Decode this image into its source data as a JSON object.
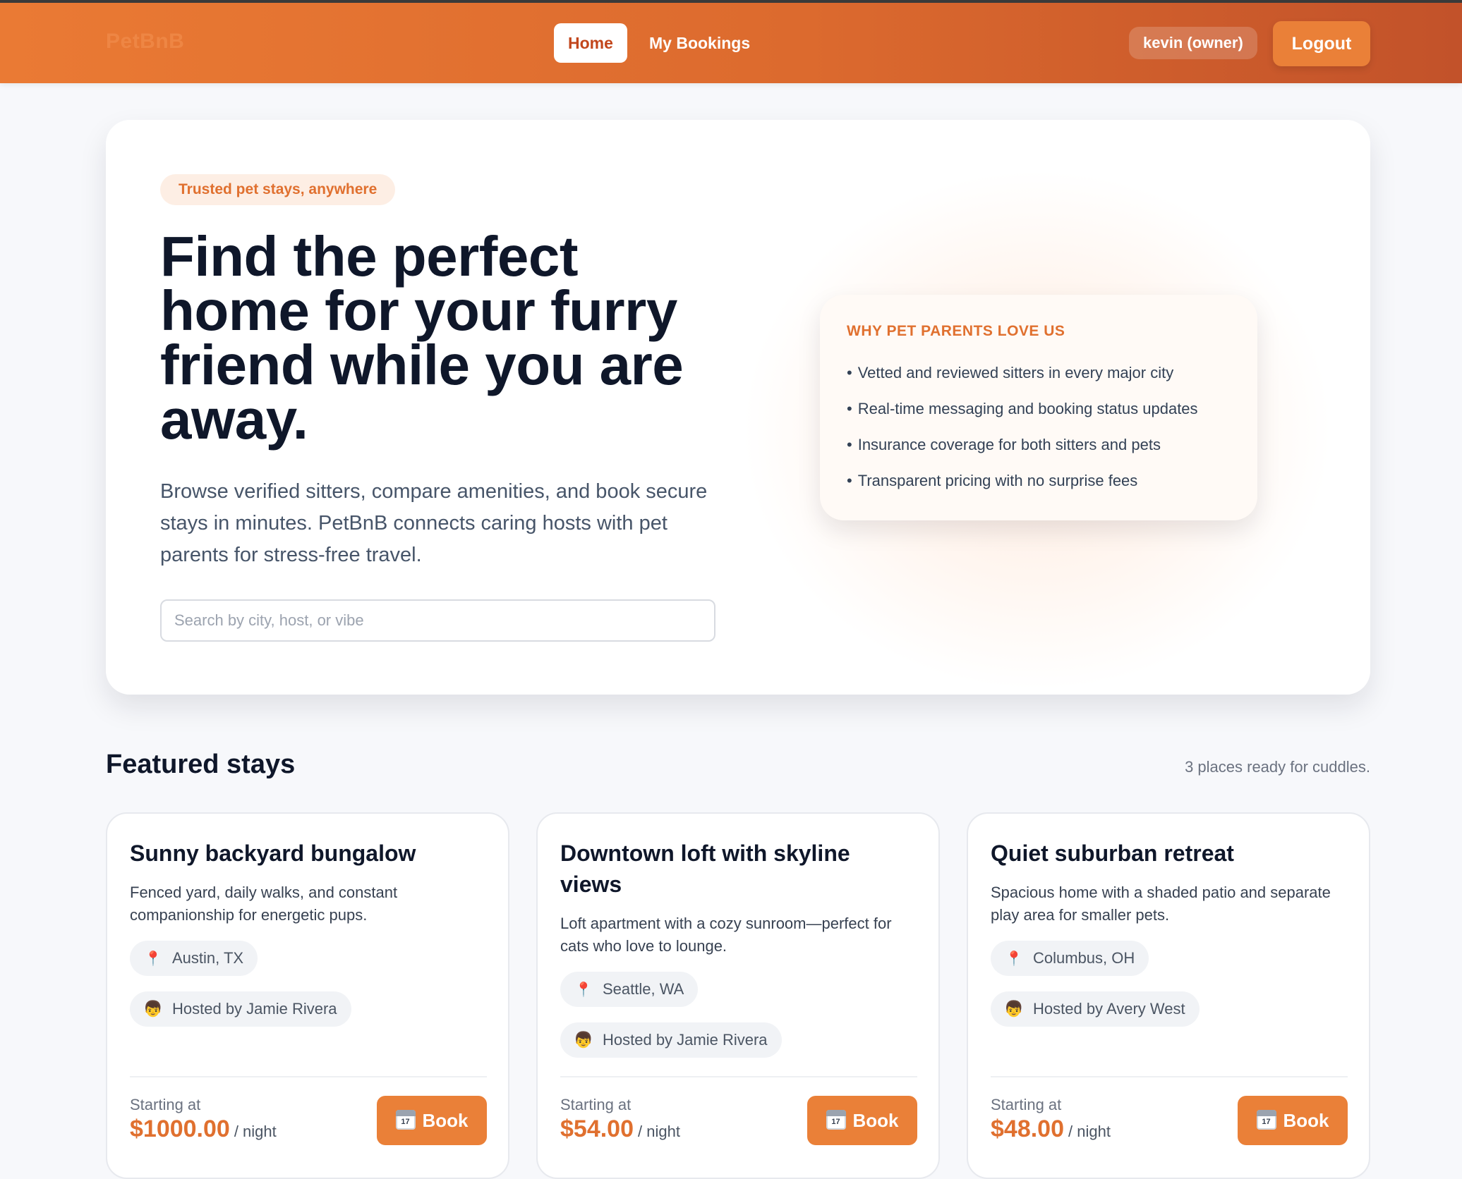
{
  "nav": {
    "brand": "PetBnB",
    "home": "Home",
    "bookings": "My Bookings",
    "user": "kevin (owner)",
    "logout": "Logout"
  },
  "hero": {
    "badge": "Trusted pet stays, anywhere",
    "title": "Find the perfect home for your furry friend while you are away.",
    "description": "Browse verified sitters, compare amenities, and book secure stays in minutes. PetBnB connects caring hosts with pet parents for stress-free travel.",
    "search_placeholder": "Search by city, host, or vibe",
    "why": {
      "title": "WHY PET PARENTS LOVE US",
      "items": [
        "Vetted and reviewed sitters in every major city",
        "Real-time messaging and booking status updates",
        "Insurance coverage for both sitters and pets",
        "Transparent pricing with no surprise fees"
      ]
    }
  },
  "featured": {
    "title": "Featured stays",
    "subtitle": "3 places ready for cuddles.",
    "stays": [
      {
        "title": "Sunny backyard bungalow",
        "description": "Fenced yard, daily walks, and constant companionship for energetic pups.",
        "location": "Austin, TX",
        "host": "Hosted by Jamie Rivera",
        "starting_label": "Starting at",
        "price": "$1000.00",
        "per_night": "/ night",
        "book_label": "Book"
      },
      {
        "title": "Downtown loft with skyline views",
        "description": "Loft apartment with a cozy sunroom—perfect for cats who love to lounge.",
        "location": "Seattle, WA",
        "host": "Hosted by Jamie Rivera",
        "starting_label": "Starting at",
        "price": "$54.00",
        "per_night": "/ night",
        "book_label": "Book"
      },
      {
        "title": "Quiet suburban retreat",
        "description": "Spacious home with a shaded patio and separate play area for smaller pets.",
        "location": "Columbus, OH",
        "host": "Hosted by Avery West",
        "starting_label": "Starting at",
        "price": "$48.00",
        "per_night": "/ night",
        "book_label": "Book"
      }
    ]
  },
  "icons": {
    "location": "map-pin-icon",
    "host": "person-face-icon",
    "book": "calendar-icon",
    "calendar_day": "17"
  },
  "colors": {
    "accent": "#ea8038",
    "accent_text": "#e0702f",
    "nav_gradient_start": "#ea7a34",
    "nav_gradient_end": "#c2522a"
  }
}
